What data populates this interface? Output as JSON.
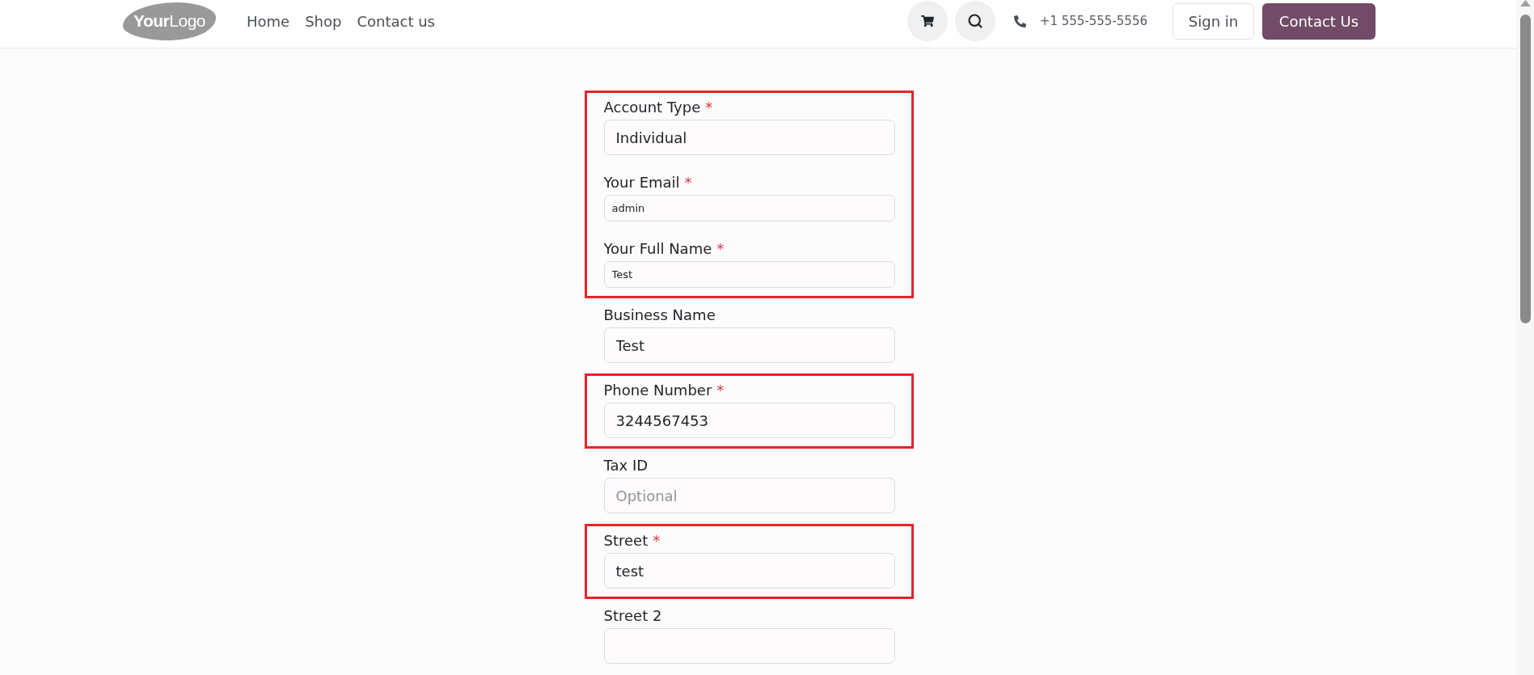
{
  "header": {
    "logo": "**Your**Logo",
    "nav": [
      "Home",
      "Shop",
      "Contact us"
    ],
    "phone": "+1 555-555-5556",
    "sign_in": "Sign in",
    "cta": "Contact Us"
  },
  "form": {
    "groups": [
      {
        "highlighted": true,
        "fields": [
          {
            "label": "Account Type",
            "required_mark": "*",
            "kind": "standard",
            "value": "Individual"
          },
          {
            "label": "Your Email",
            "required_mark": "*",
            "kind": "compact",
            "value": "admin"
          },
          {
            "label": "Your Full Name",
            "required_mark": "*",
            "kind": "compact",
            "value": "Test"
          }
        ]
      },
      {
        "highlighted": false,
        "fields": [
          {
            "label": "Business Name",
            "kind": "standard",
            "value": "Test"
          }
        ]
      },
      {
        "highlighted": true,
        "fields": [
          {
            "label": "Phone Number",
            "required_mark": "*",
            "kind": "standard",
            "value": "3244567453"
          }
        ]
      },
      {
        "highlighted": false,
        "fields": [
          {
            "label": "Tax ID",
            "kind": "standard",
            "placeholder": "Optional"
          }
        ]
      },
      {
        "highlighted": true,
        "fields": [
          {
            "label": "Street",
            "required_mark": "*",
            "kind": "standard",
            "value": "test"
          }
        ]
      },
      {
        "highlighted": false,
        "fields": [
          {
            "label": "Street 2",
            "kind": "standard"
          }
        ]
      }
    ]
  }
}
